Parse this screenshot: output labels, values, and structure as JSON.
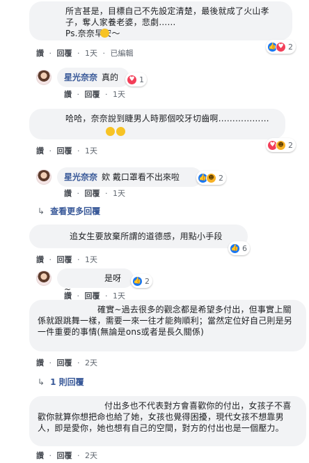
{
  "comments": [
    {
      "text": "所言甚是，目標自己不先設定清楚，最後就成了火山孝子，奪人家養老婆，悲劇……\nPs.奈奈早安～",
      "emoji_count": 1,
      "like_label": "讚",
      "reply_label": "回覆",
      "time": "1天",
      "edited": "已編輯",
      "reactions": [
        "like",
        "love"
      ],
      "reaction_count": "2"
    },
    {
      "author": "星光奈奈",
      "text": "真的",
      "like_label": "讚",
      "reply_label": "回覆",
      "time": "1天",
      "reactions": [
        "love"
      ],
      "reaction_count": "1"
    },
    {
      "text": "哈哈，奈奈說到睫男人時那個咬牙切齒啊………………",
      "emoji_count": 2,
      "like_label": "讚",
      "reply_label": "回覆",
      "time": "1天",
      "reactions": [
        "love",
        "haha"
      ],
      "reaction_count": "2"
    },
    {
      "author": "星光奈奈",
      "text": "欸 戴口罩看不出來啦",
      "like_label": "讚",
      "reply_label": "回覆",
      "time": "1天",
      "reactions": [
        "like",
        "haha"
      ],
      "reaction_count": "2"
    },
    {
      "text": "追女生要放棄所謂的道德感，用點小手段",
      "like_label": "讚",
      "reply_label": "回覆",
      "time": "1天",
      "reactions": [
        "like"
      ],
      "reaction_count": "6"
    },
    {
      "text": "是呀~",
      "like_label": "讚",
      "reply_label": "回覆",
      "time": "1天",
      "reactions": [
        "like"
      ],
      "reaction_count": "2"
    },
    {
      "text": "確實~過去很多的觀念都是希望多付出，但事實上關係就跟跳舞一樣，需要一來一往才能夠順利；當然定位好自己則是另一件重要的事情(無論是ons或者是長久關係)",
      "like_label": "讚",
      "reply_label": "回覆",
      "time": "2天"
    },
    {
      "text": "付出多也不代表對方會喜歡你的付出，女孩子不喜歡你就算你想把命也給了她，女孩也覺得困擾，現代女孩不想靠男人，即是愛你，她也想有自己的空間，對方的付出也是一個壓力。",
      "like_label": "讚",
      "reply_label": "回覆",
      "time": "2天"
    }
  ],
  "more_replies": "查看更多回覆",
  "one_reply": "1 則回覆",
  "dot": "·"
}
